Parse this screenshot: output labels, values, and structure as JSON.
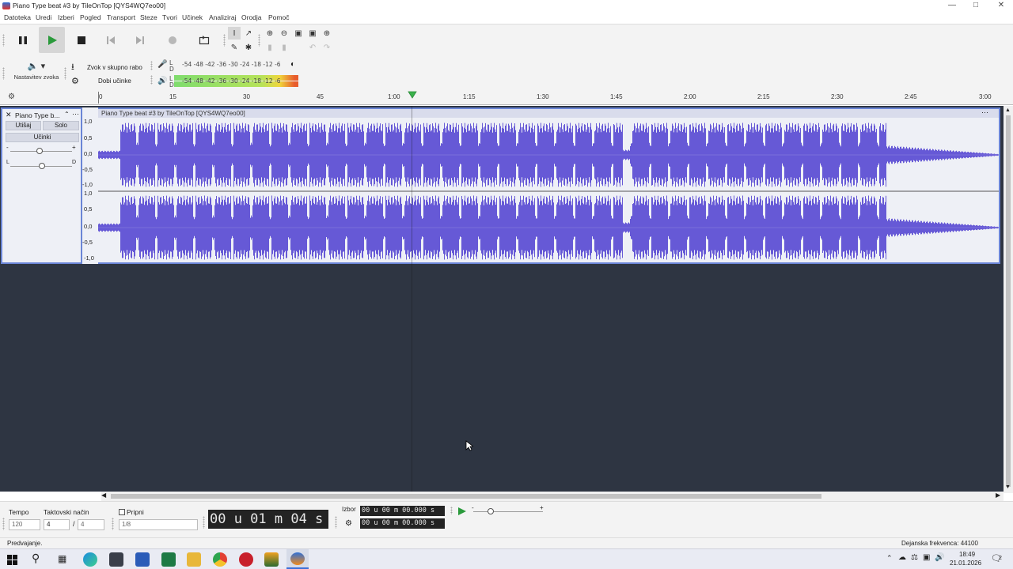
{
  "window": {
    "title": "Piano Type beat #3 by TileOnTop [QYS4WQ7eo00]"
  },
  "menu": [
    "Datoteka",
    "Uredi",
    "Izberi",
    "Pogled",
    "Transport",
    "Steze",
    "Tvori",
    "Učinek",
    "Analiziraj",
    "Orodja",
    "Pomoč"
  ],
  "toolbar": {
    "audio_setup_label": "Nastavitev zvoka",
    "share_label": "Zvok v skupno rabo",
    "effects_label": "Dobi učinke",
    "record_meter_scale": "-54  -48  -42  -36  -30  -24  -18  -12   -6",
    "play_meter_scale": "-54  -48  -42  -36  -30  -24  -18  -12   -6"
  },
  "ruler": {
    "ticks": [
      "0",
      "15",
      "30",
      "45",
      "1:00",
      "1:15",
      "1:30",
      "1:45",
      "2:00",
      "2:15",
      "2:30",
      "2:45",
      "3:00"
    ]
  },
  "track": {
    "name": "Piano Type b...",
    "clip_name": "Piano Type beat #3 by TileOnTop [QYS4WQ7eo00]",
    "mute_label": "Utišaj",
    "solo_label": "Solo",
    "effects_label": "Učinki",
    "gain_minus": "-",
    "gain_plus": "+",
    "pan_left": "L",
    "pan_right": "D",
    "scale_top": [
      "1,0",
      "0,5",
      "0,0",
      "-0,5",
      "-1,0"
    ],
    "scale_bottom": [
      "1,0",
      "0,5",
      "0,0",
      "-0,5",
      "-1,0"
    ]
  },
  "bottom": {
    "tempo_label": "Tempo",
    "tempo_value": "120",
    "meter_label": "Taktovski način",
    "meter_num": "4",
    "meter_slash": "/",
    "meter_den": "4",
    "snap_label": "Pripni",
    "snap_value": "1/8",
    "time_display": "00 u 01 m 04 s",
    "selection_label": "Izbor",
    "sel_start": "00 u 00 m 00.000 s",
    "sel_end": "00 u 00 m 00.000 s"
  },
  "status": {
    "left": "Predvajanje.",
    "right": "Dejanska frekvenca: 44100"
  },
  "taskbar": {
    "time": "18:49",
    "date": "21.01.2026",
    "notif_count": "2"
  },
  "colors": {
    "waveform": "#6659d6",
    "track_bg": "#eef0f6",
    "empty_area": "#2e3542",
    "selection_border": "#6a85d6"
  }
}
